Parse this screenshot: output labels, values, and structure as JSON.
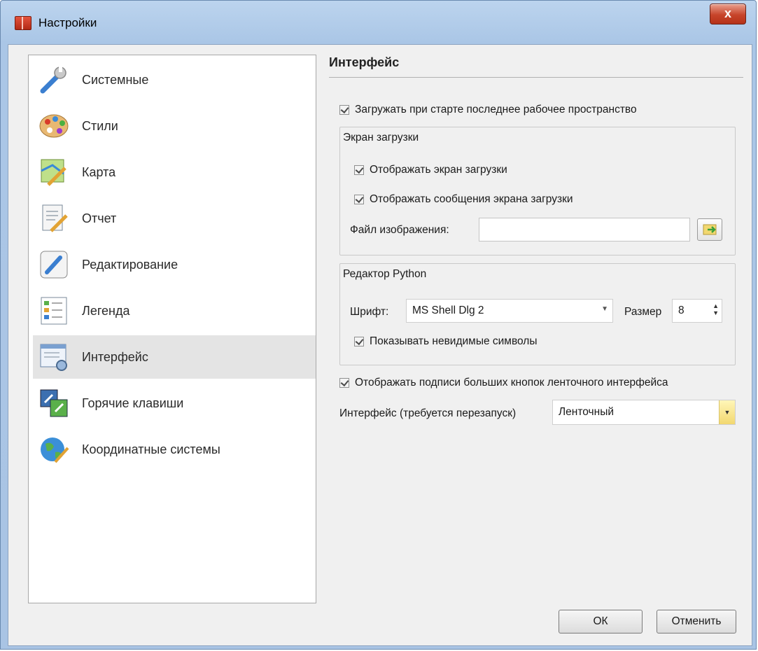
{
  "window": {
    "title": "Настройки",
    "close_label": "x"
  },
  "sidebar": {
    "items": [
      {
        "label": "Системные",
        "icon": "wrench-icon"
      },
      {
        "label": "Стили",
        "icon": "palette-icon"
      },
      {
        "label": "Карта",
        "icon": "map-icon"
      },
      {
        "label": "Отчет",
        "icon": "report-icon"
      },
      {
        "label": "Редактирование",
        "icon": "pencil-icon"
      },
      {
        "label": "Легенда",
        "icon": "legend-icon"
      },
      {
        "label": "Интерфейс",
        "icon": "interface-icon",
        "selected": true
      },
      {
        "label": "Горячие клавиши",
        "icon": "hotkeys-icon"
      },
      {
        "label": "Координатные системы",
        "icon": "globe-icon"
      }
    ]
  },
  "main": {
    "title": "Интерфейс",
    "load_last_workspace": {
      "label": "Загружать при старте последнее рабочее пространство",
      "checked": true
    },
    "splash_group": {
      "title": "Экран загрузки",
      "show_splash": {
        "label": "Отображать экран загрузки",
        "checked": true
      },
      "show_splash_messages": {
        "label": "Отображать сообщения экрана загрузки",
        "checked": true
      },
      "image_file_label": "Файл изображения:",
      "image_file_value": ""
    },
    "python_group": {
      "title": "Редактор Python",
      "font_label": "Шрифт:",
      "font_value": "MS Shell Dlg 2",
      "size_label": "Размер",
      "size_value": "8",
      "show_invisible": {
        "label": "Показывать невидимые символы",
        "checked": true
      }
    },
    "ribbon_captions": {
      "label": "Отображать подписи больших кнопок ленточного интерфейса",
      "checked": true
    },
    "interface_label": "Интерфейс (требуется перезапуск)",
    "interface_value": "Ленточный"
  },
  "footer": {
    "ok_label": "ОК",
    "cancel_label": "Отменить"
  },
  "colors": {
    "selected_item": "#e4e4e4",
    "dropdown_accent": "#f2d870"
  }
}
